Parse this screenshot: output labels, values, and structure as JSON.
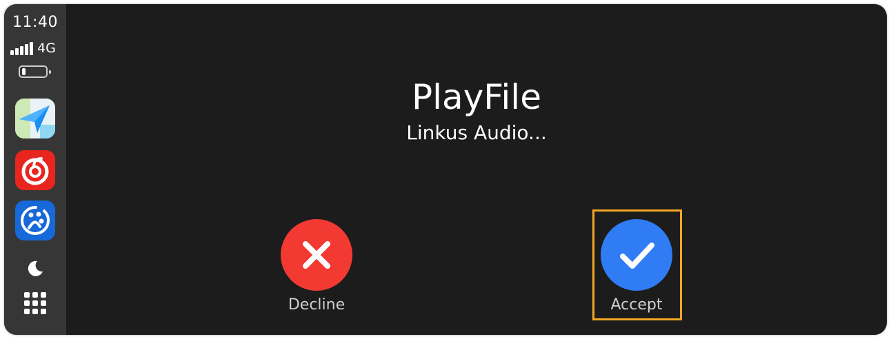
{
  "status_bar": {
    "time": "11:40",
    "network": "4G",
    "battery_level": 0.15
  },
  "dock": {
    "apps": [
      {
        "icon": "navigation-app-icon"
      },
      {
        "icon": "netease-music-app-icon"
      },
      {
        "icon": "blue-app-icon"
      }
    ],
    "night_mode_icon": "moon-icon",
    "app_grid_icon": "grid-icon"
  },
  "call": {
    "caller_name": "PlayFile",
    "caller_detail": "Linkus Audio...",
    "decline_label": "Decline",
    "accept_label": "Accept"
  },
  "colors": {
    "decline": "#f23a33",
    "accept": "#2f7cf4",
    "highlight": "#f5a623",
    "background": "#1c1c1c",
    "sidebar": "#363636"
  }
}
